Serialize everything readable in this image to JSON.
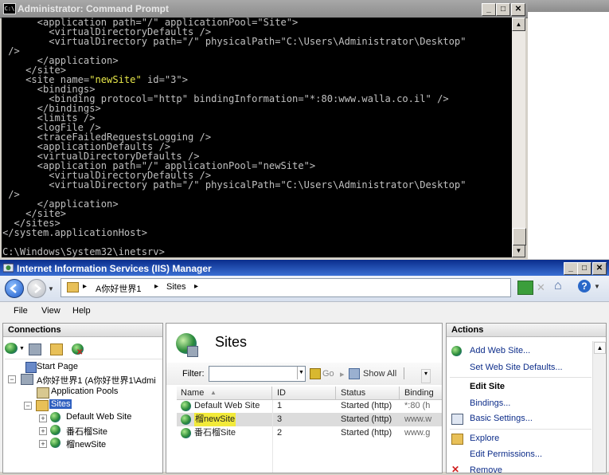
{
  "cmd": {
    "title": "Administrator: Command Prompt",
    "lines": [
      "      <application path=\"/\" applicationPool=\"Site\">",
      "        <virtualDirectoryDefaults />",
      "        <virtualDirectory path=\"/\" physicalPath=\"C:\\Users\\Administrator\\Desktop\"",
      " />",
      "      </application>",
      "    </site>",
      "    <site name=\"newSite\" id=\"3\">",
      "      <bindings>",
      "        <binding protocol=\"http\" bindingInformation=\"*:80:www.walla.co.il\" />",
      "      </bindings>",
      "      <limits />",
      "      <logFile />",
      "      <traceFailedRequestsLogging />",
      "      <applicationDefaults />",
      "      <virtualDirectoryDefaults />",
      "      <application path=\"/\" applicationPool=\"newSite\">",
      "        <virtualDirectoryDefaults />",
      "        <virtualDirectory path=\"/\" physicalPath=\"C:\\Users\\Administrator\\Desktop\"",
      " />",
      "      </application>",
      "    </site>",
      "  </sites>",
      "</system.applicationHost>",
      "",
      "C:\\Windows\\System32\\inetsrv>"
    ]
  },
  "iis": {
    "title": "Internet Information Services (IIS) Manager",
    "breadcrumb": [
      "A你好世界1",
      "Sites"
    ],
    "menu": {
      "file": "File",
      "view": "View",
      "help": "Help"
    },
    "connections": {
      "header": "Connections",
      "start_page": "Start Page",
      "server": "A你好世界1 (A你好世界1\\Admi",
      "app_pools": "Application Pools",
      "sites": "Sites",
      "site_items": [
        "Default Web Site",
        "番石榴Site",
        "榴newSite"
      ]
    },
    "center": {
      "title": "Sites",
      "filter_label": "Filter:",
      "go_label": "Go",
      "show_all_label": "Show All",
      "columns": [
        "Name",
        "ID",
        "Status",
        "Binding"
      ],
      "rows": [
        {
          "name": "Default Web Site",
          "id": "1",
          "status": "Started (http)",
          "binding": "*:80 (h"
        },
        {
          "name": "榴newSite",
          "id": "3",
          "status": "Started (http)",
          "binding": "www.w"
        },
        {
          "name": "番石榴Site",
          "id": "2",
          "status": "Started (http)",
          "binding": "www.g"
        }
      ]
    },
    "actions": {
      "header": "Actions",
      "add_site": "Add Web Site...",
      "set_defaults": "Set Web Site Defaults...",
      "edit_site_header": "Edit Site",
      "bindings": "Bindings...",
      "basic_settings": "Basic Settings...",
      "explore": "Explore",
      "edit_permissions": "Edit Permissions...",
      "remove": "Remove"
    }
  }
}
